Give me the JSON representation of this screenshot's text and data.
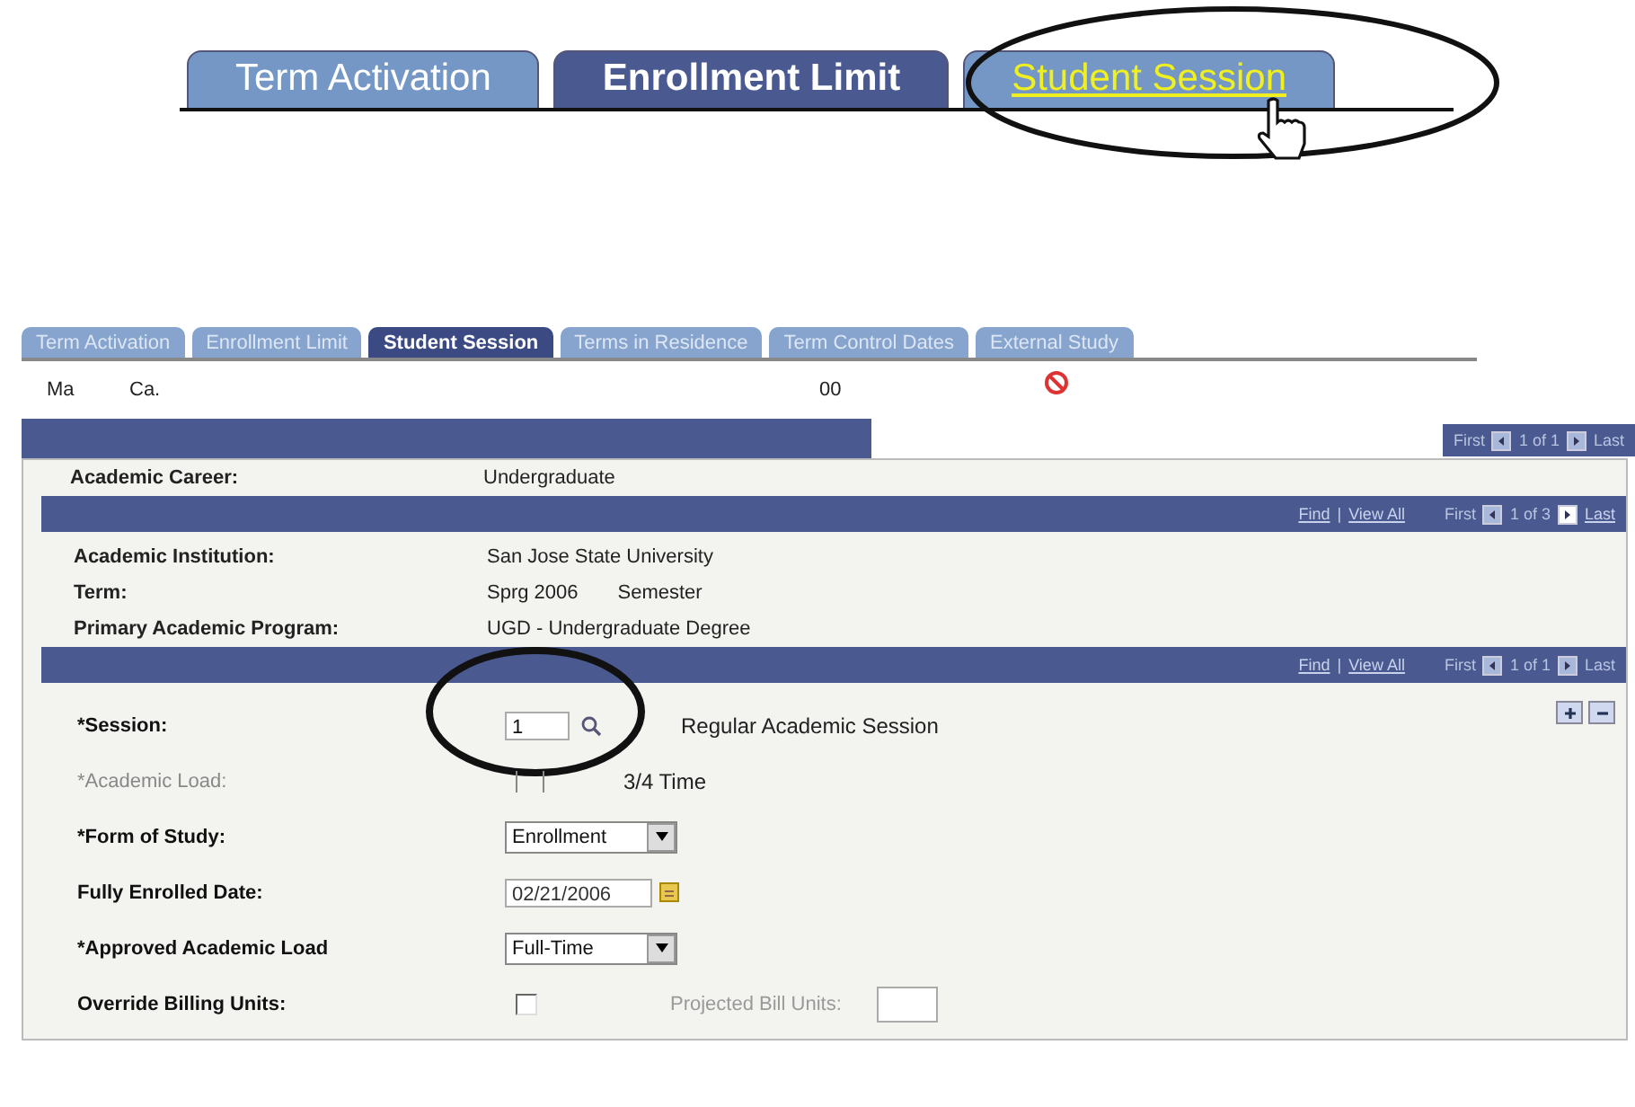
{
  "top_tabs": [
    {
      "label": "Term Activation",
      "selected": false,
      "hovered": false
    },
    {
      "label": "Enrollment Limit",
      "selected": true,
      "hovered": false
    },
    {
      "label": "Student Session",
      "selected": false,
      "hovered": true
    }
  ],
  "tabs": [
    {
      "label": "Term Activation",
      "selected": false
    },
    {
      "label": "Enrollment Limit",
      "selected": false
    },
    {
      "label": "Student Session",
      "selected": true
    },
    {
      "label": "Terms in Residence",
      "selected": false
    },
    {
      "label": "Term Control Dates",
      "selected": false
    },
    {
      "label": "External Study",
      "selected": false
    }
  ],
  "header": {
    "name": "Ma",
    "career": "Ca.",
    "id": "00"
  },
  "career_nav": {
    "first": "First",
    "count": "1 of 1",
    "last": "Last"
  },
  "career": {
    "label": "Academic Career:",
    "value": "Undergraduate"
  },
  "program_nav": {
    "find": "Find",
    "separator": "|",
    "view_all": "View All",
    "first": "First",
    "count": "1 of 3",
    "last": "Last"
  },
  "program": [
    {
      "label": "Academic Institution:",
      "value": "San Jose State University"
    },
    {
      "label": "Term:",
      "value": "Sprg 2006",
      "extra": "Semester"
    },
    {
      "label": "Primary Academic Program:",
      "value": "UGD - Undergraduate Degree"
    }
  ],
  "session_nav": {
    "find": "Find",
    "separator": "|",
    "view_all": "View All",
    "first": "First",
    "count": "1 of 1",
    "last": "Last"
  },
  "fields": [
    {
      "kind": "lookup",
      "label": "*Session:",
      "value": "1",
      "description": "Regular Academic Session",
      "disabled": false
    },
    {
      "kind": "display",
      "label": "*Academic Load:",
      "description": "3/4 Time",
      "disabled": true
    },
    {
      "kind": "select",
      "label": "*Form of Study:",
      "value": "Enrollment",
      "disabled": false
    },
    {
      "kind": "date",
      "label": "Fully Enrolled Date:",
      "value": "02/21/2006",
      "disabled": false
    },
    {
      "kind": "select",
      "label": "*Approved Academic Load",
      "value": "Full-Time",
      "disabled": false
    },
    {
      "kind": "checkbox",
      "label": "Override Billing Units:",
      "checked": false,
      "extra_label": "Projected Bill Units:",
      "disabled": false
    }
  ]
}
